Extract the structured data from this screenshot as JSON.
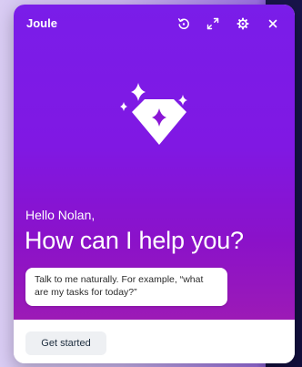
{
  "app": {
    "title": "Joule"
  },
  "header": {
    "icons": [
      "history-icon",
      "expand-icon",
      "settings-icon",
      "close-icon"
    ]
  },
  "hero": {
    "icon": "diamond-sparkle-icon",
    "greeting": "Hello Nolan,",
    "headline": "How can I help you?",
    "prompt_hint": "Talk to me naturally. For example, “what are my tasks for today?”"
  },
  "footer": {
    "start_label": "Get started"
  },
  "colors": {
    "gradient_top": "#7a1de9",
    "gradient_bottom": "#9c1ab6",
    "text_on_hero": "#ffffff",
    "button_bg": "#eef0f3"
  }
}
